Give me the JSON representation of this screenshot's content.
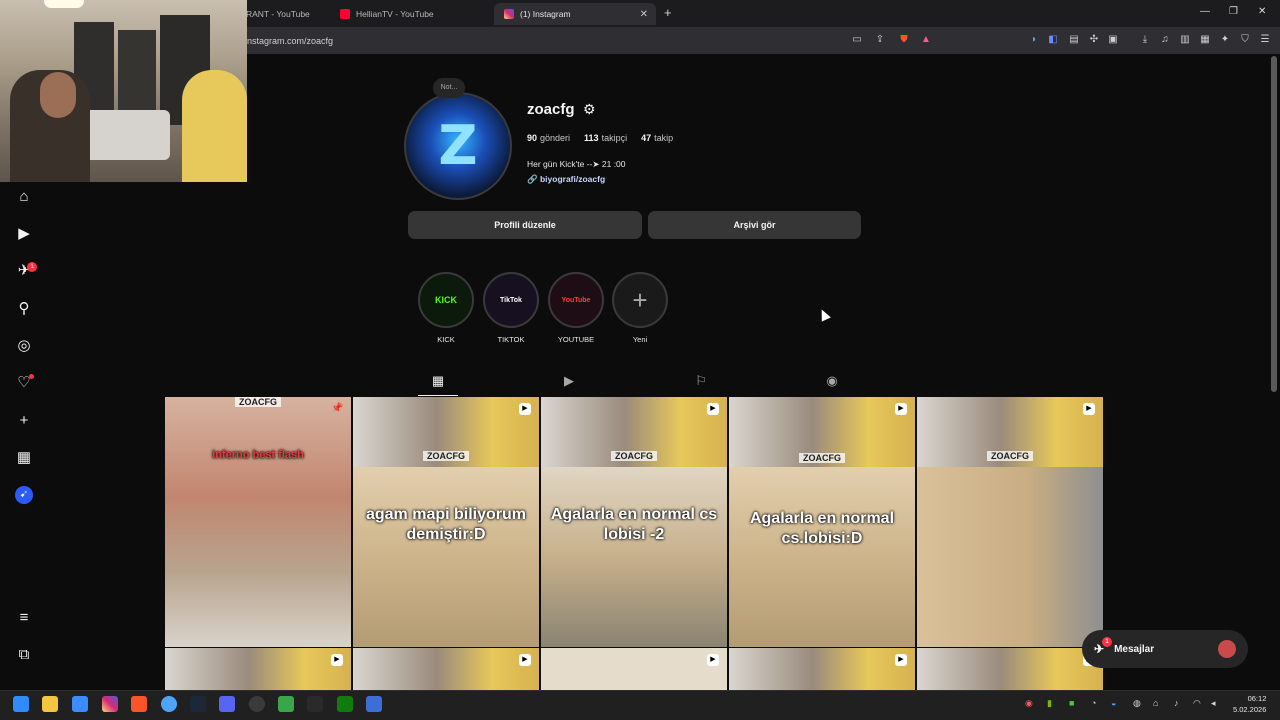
{
  "browser": {
    "tabs": [
      {
        "label": "RANT - YouTube",
        "favicon": "youtube-icon",
        "active": false
      },
      {
        "label": "HellianTV - YouTube",
        "favicon": "youtube-icon",
        "active": false
      },
      {
        "label": "(1) Instagram",
        "favicon": "instagram-icon",
        "active": true
      }
    ],
    "url": "instagram.com/zoacfg"
  },
  "nav": {
    "items": [
      "home-icon",
      "reels-icon",
      "messages-icon",
      "search-icon",
      "explore-icon",
      "notifications-icon",
      "create-icon",
      "dashboard-icon",
      "profile-icon",
      "more-icon",
      "meta-icon"
    ],
    "messages_badge": "1"
  },
  "profile": {
    "note": "Not...",
    "username": "zoacfg",
    "posts_count": "90",
    "posts_label": "gönderi",
    "followers_count": "113",
    "followers_label": "takipçi",
    "following_count": "47",
    "following_label": "takip",
    "bio": "Her gün Kick'te --➤ 21 :00",
    "link": "biyografi/zoacfg",
    "edit_button": "Profili düzenle",
    "archive_button": "Arşivi gör"
  },
  "highlights": [
    {
      "label": "KICK",
      "cover": "KICK",
      "color": "#53fc18"
    },
    {
      "label": "TIKTOK",
      "cover": "TikTok",
      "color": "#ffffff"
    },
    {
      "label": "YOUTUBE",
      "cover": "YouTube",
      "color": "#ff3d3d"
    },
    {
      "label": "Yeni",
      "cover": "+",
      "color": "#a8a8a8"
    }
  ],
  "profile_tabs": [
    "grid-icon",
    "reels-tab-icon",
    "saved-icon",
    "tagged-icon"
  ],
  "posts": [
    {
      "tagline": "ZOACFG",
      "caption": "",
      "overlay": "inferno best flash",
      "pinned": true
    },
    {
      "tagline": "ZOACFG",
      "caption": "agam mapi biliyorum demiştir:D",
      "pinned": false
    },
    {
      "tagline": "ZOACFG",
      "caption": "Agalarla en normal cs lobisi -2",
      "pinned": false
    },
    {
      "tagline": "ZOACFG",
      "caption": "Agalarla en normal cs.lobisi:D",
      "pinned": false
    },
    {
      "tagline": "ZOACFG",
      "caption": "",
      "pinned": false
    }
  ],
  "messages_label": "Mesajlar",
  "messages_badge": "1",
  "taskbar": {
    "time": "06:12",
    "date": "5.02.2026"
  }
}
